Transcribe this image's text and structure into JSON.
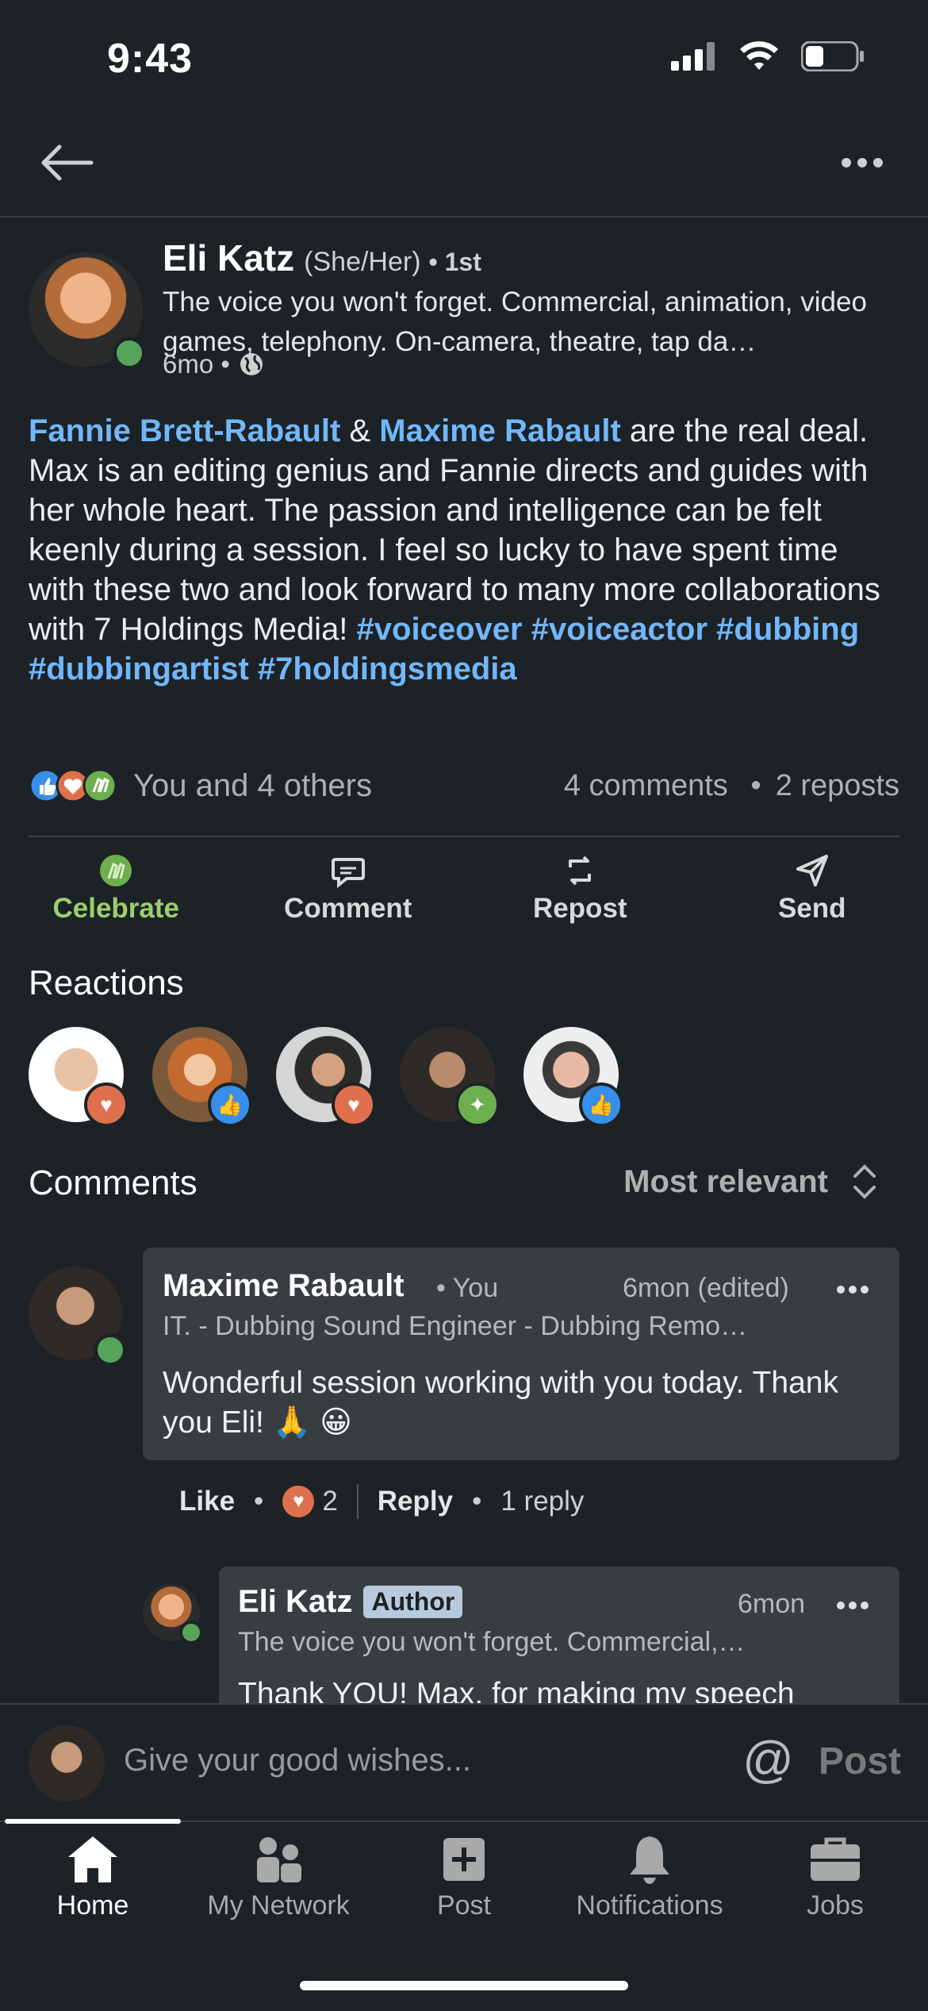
{
  "status_bar": {
    "time": "9:43"
  },
  "post": {
    "author": {
      "name": "Eli Katz",
      "pronouns": "(She/Her)",
      "degree": "• 1st",
      "headline": "The voice you won't forget. Commercial, animation, video games, telephony. On-camera, theatre, tap da…",
      "age": "6mo •"
    },
    "body": {
      "mention1": "Fannie Brett-Rabault",
      "amp": " & ",
      "mention2": "Maxime Rabault",
      "text": " are the real deal. Max is an editing genius and Fannie directs and guides with her whole heart. The passion and intelligence can be felt keenly during a session. I feel so lucky to have spent time with these two and look forward to many more collaborations with 7 Holdings Media! ",
      "hashtags": [
        "#voiceover",
        "#voiceactor",
        "#dubbing",
        "#dubbingartist",
        "#7holdingsmedia"
      ]
    },
    "stats": {
      "reactions_text": "You and 4 others",
      "comments": "4 comments",
      "sep": "•",
      "reposts": "2 reposts"
    },
    "actions": [
      {
        "label": "Celebrate",
        "icon": "celebrate-icon"
      },
      {
        "label": "Comment",
        "icon": "comment-icon"
      },
      {
        "label": "Repost",
        "icon": "repost-icon"
      },
      {
        "label": "Send",
        "icon": "send-icon"
      }
    ]
  },
  "reactions": {
    "title": "Reactions"
  },
  "comments": {
    "title": "Comments",
    "sort_label": "Most relevant",
    "first": {
      "name": "Maxime Rabault",
      "you": "• You",
      "time": "6mon (edited)",
      "headline": "IT. - Dubbing Sound Engineer - Dubbing Remo…",
      "text": "Wonderful session working with you today. Thank you Eli! 🙏 😀",
      "like": "Like",
      "dot": "•",
      "reaction_count": "2",
      "reply": "Reply",
      "replies": "1 reply"
    },
    "reply": {
      "name": "Eli Katz",
      "tag": "Author",
      "time": "6mon",
      "headline": "The voice you won't forget. Commercial,…",
      "text": "Thank YOU! Max, for making my speech"
    }
  },
  "composer": {
    "placeholder": "Give your good wishes...",
    "at": "@",
    "post": "Post"
  },
  "tabs": [
    {
      "label": "Home",
      "icon": "home-icon"
    },
    {
      "label": "My Network",
      "icon": "network-icon"
    },
    {
      "label": "Post",
      "icon": "post-icon"
    },
    {
      "label": "Notifications",
      "icon": "bell-icon"
    },
    {
      "label": "Jobs",
      "icon": "briefcase-icon"
    }
  ],
  "colors": {
    "background": "#1d2226",
    "link": "#71b7fb",
    "celebrate": "#9ccf6d"
  }
}
